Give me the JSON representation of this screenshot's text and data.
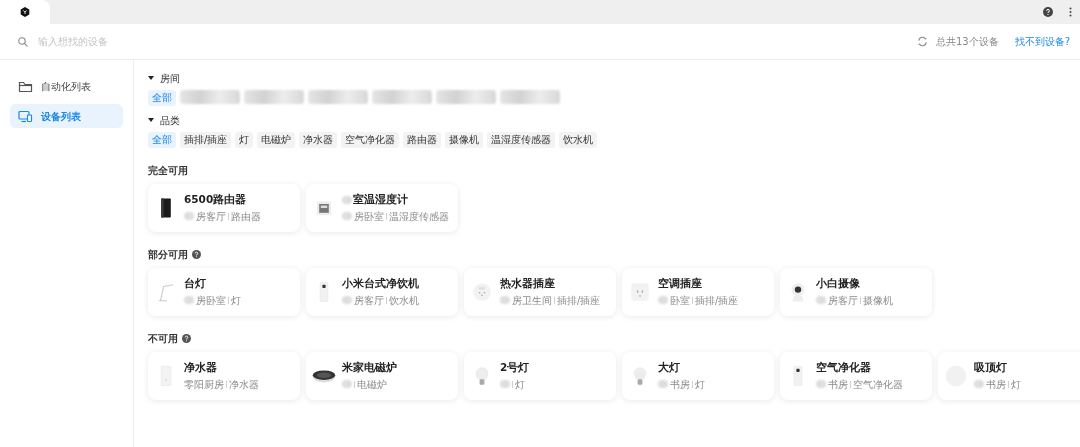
{
  "search": {
    "placeholder": "输入想找的设备"
  },
  "total": "总共13个设备",
  "help_link": "找不到设备?",
  "sidebar": {
    "items": [
      {
        "label": "自动化列表",
        "kind": "folder",
        "selected": false
      },
      {
        "label": "设备列表",
        "kind": "devices",
        "selected": true
      }
    ]
  },
  "filters": [
    {
      "title": "房间",
      "expanded": true,
      "chips": [
        {
          "label": "全部",
          "selected": true
        },
        {
          "kind": "blurred"
        },
        {
          "kind": "blurred"
        },
        {
          "kind": "blurred"
        },
        {
          "kind": "blurred"
        },
        {
          "kind": "blurred"
        },
        {
          "kind": "blurred"
        }
      ]
    },
    {
      "title": "品类",
      "expanded": true,
      "chips": [
        {
          "label": "全部",
          "selected": true
        },
        {
          "label": "插排/插座",
          "selected": false
        },
        {
          "label": "灯",
          "selected": false
        },
        {
          "label": "电磁炉",
          "selected": false
        },
        {
          "label": "净水器",
          "selected": false
        },
        {
          "label": "空气净化器",
          "selected": false
        },
        {
          "label": "路由器",
          "selected": false
        },
        {
          "label": "摄像机",
          "selected": false
        },
        {
          "label": "温湿度传感器",
          "selected": false
        },
        {
          "label": "饮水机",
          "selected": false
        }
      ]
    }
  ],
  "groups": [
    {
      "title": "完全可用",
      "help": false,
      "devices": [
        {
          "kind": "router",
          "name": "6500路由器",
          "room": "房客厅",
          "room_blurred": true,
          "category": "路由器"
        },
        {
          "kind": "sensor",
          "name": "室温湿度计",
          "name_blurred": true,
          "room": "房卧室",
          "room_blurred": true,
          "category": "温湿度传感器"
        }
      ]
    },
    {
      "title": "部分可用",
      "help": true,
      "devices": [
        {
          "kind": "lamp",
          "name": "台灯",
          "room": "房卧室",
          "room_blurred": true,
          "category": "灯"
        },
        {
          "kind": "tower",
          "name": "小米台式净饮机",
          "room": "房客厅",
          "room_blurred": true,
          "category": "饮水机"
        },
        {
          "kind": "round-socket",
          "name": "热水器插座",
          "room": "房卫生间",
          "room_blurred": true,
          "category": "插排/插座"
        },
        {
          "kind": "square-socket",
          "name": "空调插座",
          "room": "卧室",
          "room_blurred": true,
          "category": "插排/插座"
        },
        {
          "kind": "camera",
          "name": "小白摄像",
          "room": "房客厅",
          "room_blurred": true,
          "category": "摄像机"
        }
      ]
    },
    {
      "title": "不可用",
      "help": true,
      "devices": [
        {
          "kind": "box",
          "name": "净水器",
          "room": "零阳厨房",
          "room_blurred": false,
          "category": "净水器"
        },
        {
          "kind": "cooker",
          "name": "米家电磁炉",
          "room_blurred": true,
          "category": "电磁炉"
        },
        {
          "kind": "bulb",
          "name": "2号灯",
          "room_blurred": true,
          "category": "灯"
        },
        {
          "kind": "bulb",
          "name": "大灯",
          "room": "书房",
          "room_blurred": true,
          "category": "灯"
        },
        {
          "kind": "tower",
          "name": "空气净化器",
          "room": "书房",
          "room_blurred": true,
          "category": "空气净化器"
        },
        {
          "kind": "ceiling",
          "name": "吸顶灯",
          "room": "书房",
          "room_blurred": true,
          "category": "灯"
        }
      ]
    }
  ]
}
